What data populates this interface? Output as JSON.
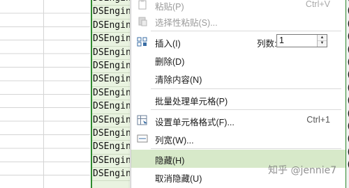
{
  "sheet": {
    "col_c_text": "DSEngine",
    "col_d_text": "(",
    "row_count": 14
  },
  "menu": {
    "paste": {
      "label": "粘贴(P)",
      "shortcut": "Ctrl+V"
    },
    "paste_special": {
      "label": "选择性粘贴(S)..."
    },
    "insert": {
      "label": "插入(I)",
      "count_label": "列数:",
      "count_value": "1"
    },
    "delete": {
      "label": "删除(D)"
    },
    "clear": {
      "label": "清除内容(N)"
    },
    "batch": {
      "label": "批量处理单元格(P)"
    },
    "format": {
      "label": "设置单元格格式(F)...",
      "shortcut": "Ctrl+1"
    },
    "col_width": {
      "label": "列宽(W)..."
    },
    "hide": {
      "label": "隐藏(H)"
    },
    "unhide": {
      "label": "取消隐藏(U)"
    }
  },
  "watermark": "知乎 @jennie7",
  "colors": {
    "selection_border": "#2e8b2e",
    "selection_fill": "#e9f3e0",
    "menu_highlight": "#d7e9c9"
  }
}
